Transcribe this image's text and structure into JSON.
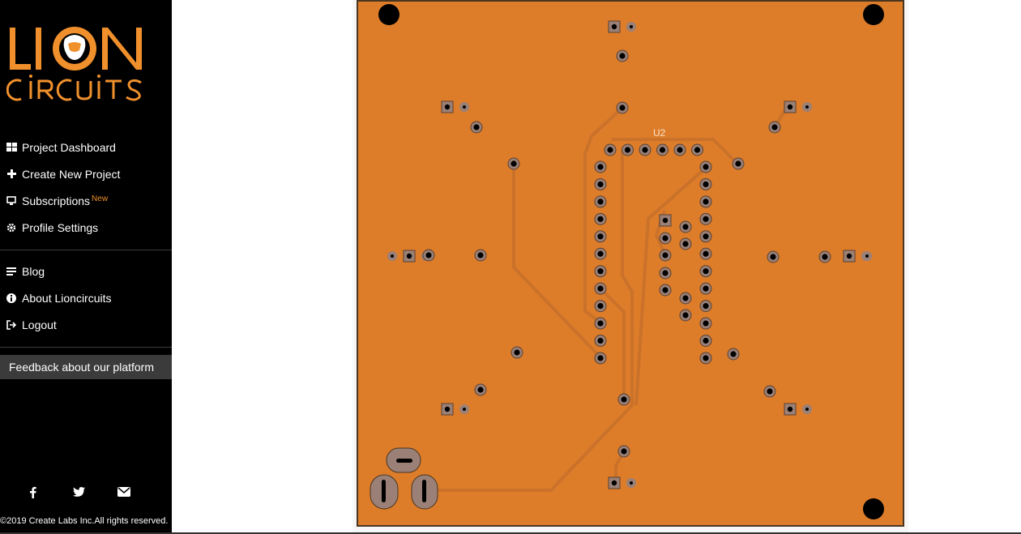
{
  "brand": {
    "logo_line1": "LION",
    "logo_line2": "CIRCUITS",
    "accent_color": "#f0902c"
  },
  "nav": {
    "primary": [
      {
        "label": "Project Dashboard",
        "icon": "dashboard-icon"
      },
      {
        "label": "Create New Project",
        "icon": "plus-icon"
      },
      {
        "label": "Subscriptions",
        "icon": "monitor-icon",
        "badge": "New"
      },
      {
        "label": "Profile Settings",
        "icon": "gear-icon"
      }
    ],
    "secondary": [
      {
        "label": "Blog",
        "icon": "blog-icon"
      },
      {
        "label": "About Lioncircuits",
        "icon": "info-icon"
      },
      {
        "label": "Logout",
        "icon": "logout-icon"
      }
    ],
    "feedback_label": "Feedback about our platform"
  },
  "social": [
    "facebook-icon",
    "twitter-icon",
    "email-icon"
  ],
  "footer": {
    "copyright": "©2019 Create Labs Inc.All rights reserved."
  },
  "pcb": {
    "component_label": "U2",
    "board_color": "#dd7d2a",
    "pad_color": "#9a8076"
  }
}
